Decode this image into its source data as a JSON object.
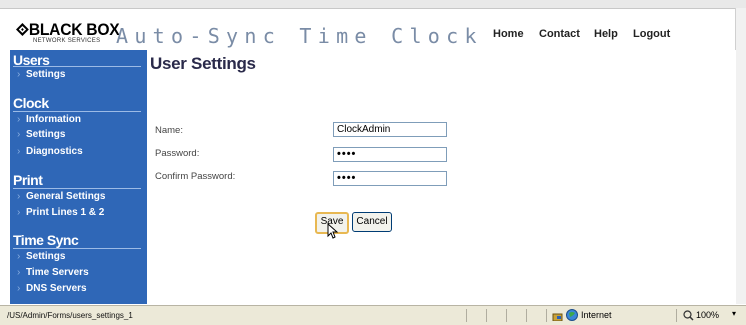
{
  "header": {
    "logo_text": "BLACK BOX",
    "logo_subtext": "NETWORK SERVICES",
    "app_title": "Auto-Sync Time Clock",
    "nav": [
      "Home",
      "Contact",
      "Help",
      "Logout"
    ]
  },
  "sidebar": {
    "sections": [
      {
        "title": "Users",
        "items": [
          "Settings"
        ]
      },
      {
        "title": "Clock",
        "items": [
          "Information",
          "Settings",
          "Diagnostics"
        ]
      },
      {
        "title": "Print",
        "items": [
          "General Settings",
          "Print Lines 1 & 2"
        ]
      },
      {
        "title": "Time Sync",
        "items": [
          "Settings",
          "Time Servers",
          "DNS Servers"
        ]
      }
    ]
  },
  "main": {
    "title": "User Settings",
    "fields": [
      {
        "label": "Name:",
        "value": "ClockAdmin"
      },
      {
        "label": "Password:",
        "value": "••••"
      },
      {
        "label": "Confirm Password:",
        "value": "••••"
      }
    ],
    "buttons": {
      "save": "Save",
      "cancel": "Cancel"
    }
  },
  "statusbar": {
    "url": "/US/Admin/Forms/users_settings_1",
    "zone": "Internet",
    "zoom": "100%"
  },
  "colors": {
    "sidebar_bg": "#2f67b7",
    "title_gray": "#7a8ca6"
  }
}
